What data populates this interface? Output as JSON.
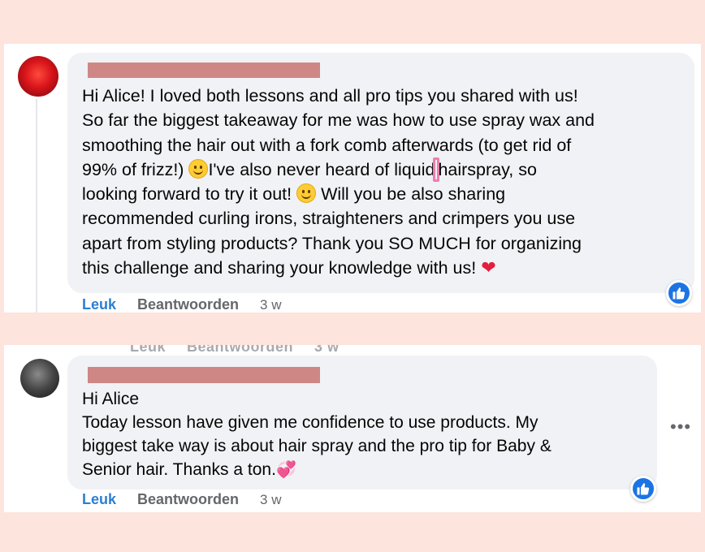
{
  "comments": [
    {
      "lines": [
        "Hi Alice! I loved both lessons and all pro tips you shared with us!",
        "So far the biggest takeaway for me was how to use spray wax and",
        "smoothing the hair out with a fork comb afterwards (to get rid of",
        "99% of frizz!) ",
        "I've also never heard of liquid",
        "hairspray, so",
        "looking forward to try it out! ",
        " Will you be also sharing",
        "recommended curling irons, straighteners and crimpers you use",
        "apart from styling products? Thank you SO MUCH for organizing",
        "this challenge and sharing your knowledge with us! "
      ],
      "like_label": "Leuk",
      "reply_label": "Beantwoorden",
      "time": "3 w"
    },
    {
      "ghost_like": "Leuk",
      "ghost_reply": "Beantwoorden",
      "ghost_time": "3 w",
      "lines": [
        "Hi Alice",
        "Today lesson have given me confidence to use products. My",
        "biggest take way is about hair spray and the pro tip for Baby &",
        "Senior hair. Thanks a ton."
      ],
      "like_label": "Leuk",
      "reply_label": "Beantwoorden",
      "time": "3 w"
    }
  ],
  "icons": {
    "smile": "slightly-smiling-face-icon",
    "heart": "red-heart-icon",
    "hearts": "two-hearts-icon",
    "like": "like-thumb-icon",
    "more": "more-options-icon"
  },
  "colors": {
    "background": "#fde4dd",
    "bubble": "#f0f2f5",
    "link_blue": "#2d7fd1",
    "like_badge": "#1b74e4",
    "redaction": "#cf8786"
  }
}
